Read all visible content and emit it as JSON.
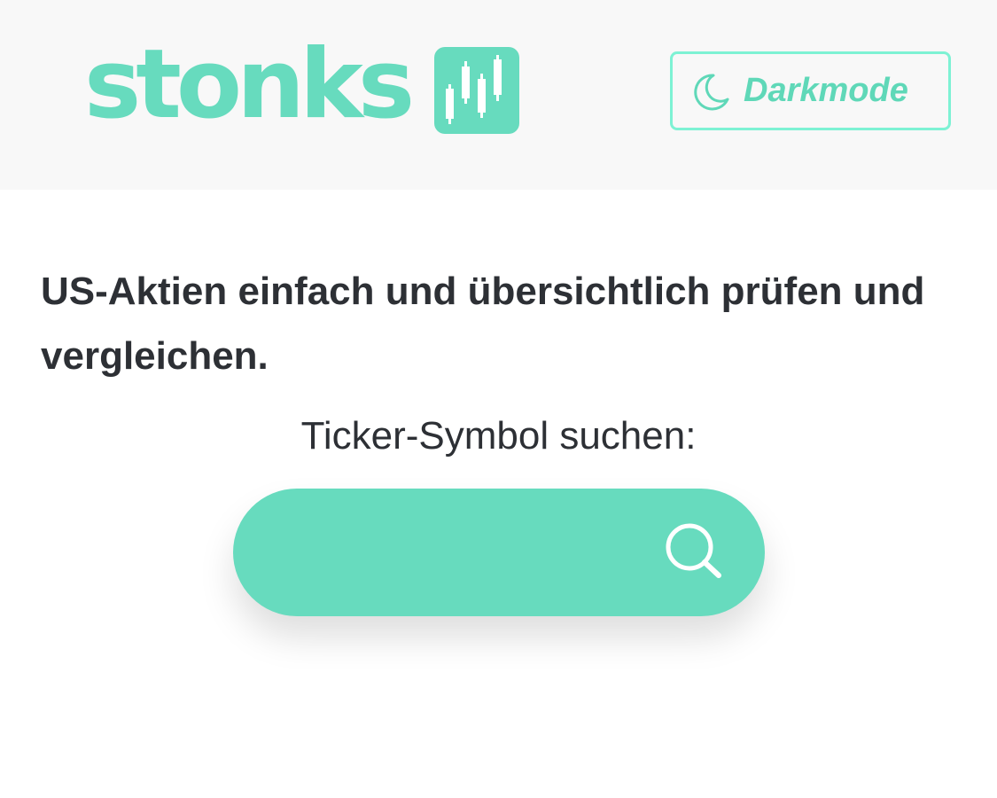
{
  "header": {
    "logo_text": "stonks",
    "darkmode_label": "Darkmode"
  },
  "main": {
    "tagline": "US-Aktien einfach und übersichtlich prüfen und vergleichen.",
    "search": {
      "label": "Ticker-Symbol suchen:",
      "value": "",
      "placeholder": ""
    }
  },
  "icons": {
    "logo": "candlestick-chart-icon",
    "darkmode": "moon-icon",
    "search": "search-icon"
  },
  "colors": {
    "brand": "#67dbbe",
    "brand_border": "#7ef2d4",
    "header_background": "#f8f8f8",
    "text": "#2d3035"
  }
}
